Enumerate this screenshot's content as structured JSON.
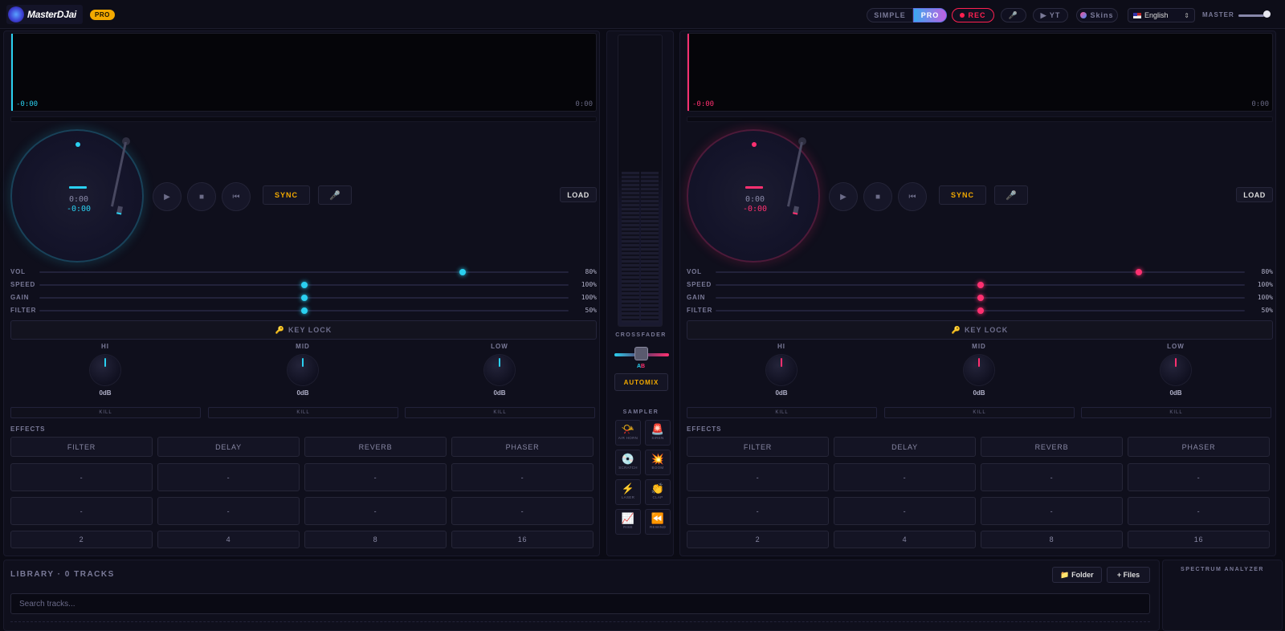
{
  "app": {
    "logo_text": "MasterDJai",
    "pro_badge": "PRO"
  },
  "topbar": {
    "mode_simple": "SIMPLE",
    "mode_pro": "PRO",
    "active_mode": "PRO",
    "rec_label": "REC",
    "mic_icon": "🎤",
    "yt_label": "▶ YT",
    "skins_label": "Skins",
    "language": "English",
    "master_label": "MASTER",
    "master_level": 0.8
  },
  "colors": {
    "deck_a_accent": "#2ad0f0",
    "deck_b_accent": "#ff3070",
    "highlight": "#f2a900"
  },
  "deck_a": {
    "wave_time_left": "-0:00",
    "wave_time_right": "0:00",
    "platter_time": "0:00",
    "platter_remaining": "-0:00",
    "play_icon": "▶",
    "stop_icon": "■",
    "cue_icon": "⏮",
    "sync_label": "SYNC",
    "mic_icon": "🎤",
    "load_label": "LOAD",
    "sliders": [
      {
        "label": "VOL",
        "value": "80%",
        "pos": 0.8
      },
      {
        "label": "SPEED",
        "value": "100%",
        "pos": 0.5
      },
      {
        "label": "GAIN",
        "value": "100%",
        "pos": 0.5
      },
      {
        "label": "FILTER",
        "value": "50%",
        "pos": 0.5
      }
    ],
    "key_lock_label": "KEY LOCK",
    "key_icon": "🔑",
    "eq": [
      {
        "label": "HI",
        "db": "0dB",
        "kill": "KILL"
      },
      {
        "label": "MID",
        "db": "0dB",
        "kill": "KILL"
      },
      {
        "label": "LOW",
        "db": "0dB",
        "kill": "KILL"
      }
    ],
    "effects_label": "EFFECTS",
    "effects": [
      "FILTER",
      "DELAY",
      "REVERB",
      "PHASER"
    ],
    "fx_row1": [
      "-",
      "-",
      "-",
      "-"
    ],
    "fx_row2": [
      "-",
      "-",
      "-",
      "-"
    ],
    "beats": [
      "2",
      "4",
      "8",
      "16"
    ]
  },
  "deck_b": {
    "wave_time_left": "-0:00",
    "wave_time_right": "0:00",
    "platter_time": "0:00",
    "platter_remaining": "-0:00",
    "play_icon": "▶",
    "stop_icon": "■",
    "cue_icon": "⏮",
    "sync_label": "SYNC",
    "mic_icon": "🎤",
    "load_label": "LOAD",
    "sliders": [
      {
        "label": "VOL",
        "value": "80%",
        "pos": 0.8
      },
      {
        "label": "SPEED",
        "value": "100%",
        "pos": 0.5
      },
      {
        "label": "GAIN",
        "value": "100%",
        "pos": 0.5
      },
      {
        "label": "FILTER",
        "value": "50%",
        "pos": 0.5
      }
    ],
    "key_lock_label": "KEY LOCK",
    "key_icon": "🔑",
    "eq": [
      {
        "label": "HI",
        "db": "0dB",
        "kill": "KILL"
      },
      {
        "label": "MID",
        "db": "0dB",
        "kill": "KILL"
      },
      {
        "label": "LOW",
        "db": "0dB",
        "kill": "KILL"
      }
    ],
    "effects_label": "EFFECTS",
    "effects": [
      "FILTER",
      "DELAY",
      "REVERB",
      "PHASER"
    ],
    "fx_row1": [
      "-",
      "-",
      "-",
      "-"
    ],
    "fx_row2": [
      "-",
      "-",
      "-",
      "-"
    ],
    "beats": [
      "2",
      "4",
      "8",
      "16"
    ]
  },
  "mixer": {
    "crossfader_label": "CROSSFADER",
    "crossfader_a": "A",
    "crossfader_b": "B",
    "crossfader_pos": 0.5,
    "automix_label": "AUTOMIX",
    "sampler_label": "SAMPLER",
    "pads": [
      {
        "icon": "📯",
        "label": "AIR HORN"
      },
      {
        "icon": "🚨",
        "label": "SIREN"
      },
      {
        "icon": "💿",
        "label": "SCRATCH"
      },
      {
        "icon": "💥",
        "label": "BOOM"
      },
      {
        "icon": "⚡",
        "label": "LASER"
      },
      {
        "icon": "👏",
        "label": "CLAP"
      },
      {
        "icon": "📈",
        "label": "RISE"
      },
      {
        "icon": "⏪",
        "label": "REWIND"
      }
    ]
  },
  "library": {
    "title": "LIBRARY · 0 TRACKS",
    "folder_label": "📁 Folder",
    "files_label": "+ Files",
    "search_placeholder": "Search tracks..."
  },
  "spectrum": {
    "title": "SPECTRUM ANALYZER"
  }
}
